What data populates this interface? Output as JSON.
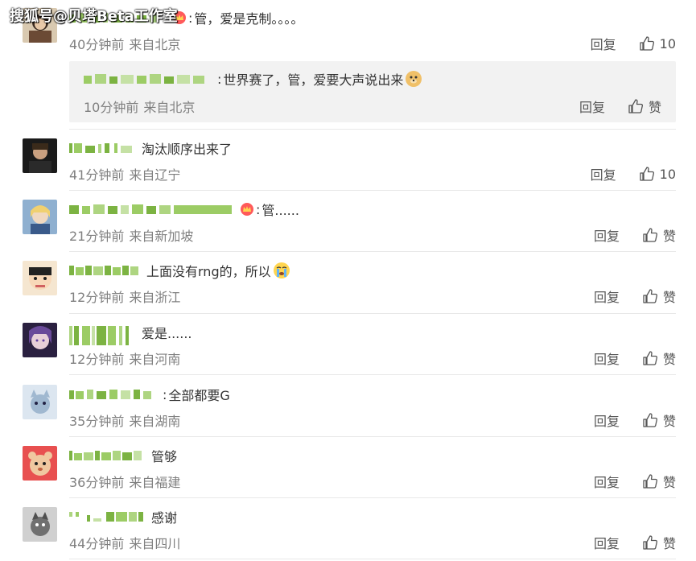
{
  "watermark": "搜狐号@贝塔Beta工作室",
  "comments": [
    {
      "text": "管，爱是克制。。。。",
      "time": "40分钟前",
      "location": "来自北京",
      "reply_label": "回复",
      "like_label": "10",
      "has_crown": true,
      "sub_reply": {
        "text": "世界赛了，管，爱要大声说出来",
        "time": "10分钟前",
        "location": "来自北京",
        "reply_label": "回复",
        "like_label": "赞"
      }
    },
    {
      "text": "淘汰顺序出来了",
      "time": "41分钟前",
      "location": "来自辽宁",
      "reply_label": "回复",
      "like_label": "10"
    },
    {
      "text": "管......",
      "time": "21分钟前",
      "location": "来自新加坡",
      "reply_label": "回复",
      "like_label": "赞",
      "has_crown": true
    },
    {
      "text": "上面没有rng的，所以",
      "time": "12分钟前",
      "location": "来自浙江",
      "reply_label": "回复",
      "like_label": "赞"
    },
    {
      "text": "爱是......",
      "time": "12分钟前",
      "location": "来自河南",
      "reply_label": "回复",
      "like_label": "赞"
    },
    {
      "text": "全部都要G",
      "time": "35分钟前",
      "location": "来自湖南",
      "reply_label": "回复",
      "like_label": "赞"
    },
    {
      "text": "管够",
      "time": "36分钟前",
      "location": "来自福建",
      "reply_label": "回复",
      "like_label": "赞"
    },
    {
      "text": "感谢",
      "time": "44分钟前",
      "location": "来自四川",
      "reply_label": "回复",
      "like_label": "赞"
    }
  ],
  "colors": {
    "username_blur": "#7cb342",
    "meta_text": "#808080",
    "divider": "#e8e8e8",
    "sub_reply_bg": "#f2f2f2"
  }
}
